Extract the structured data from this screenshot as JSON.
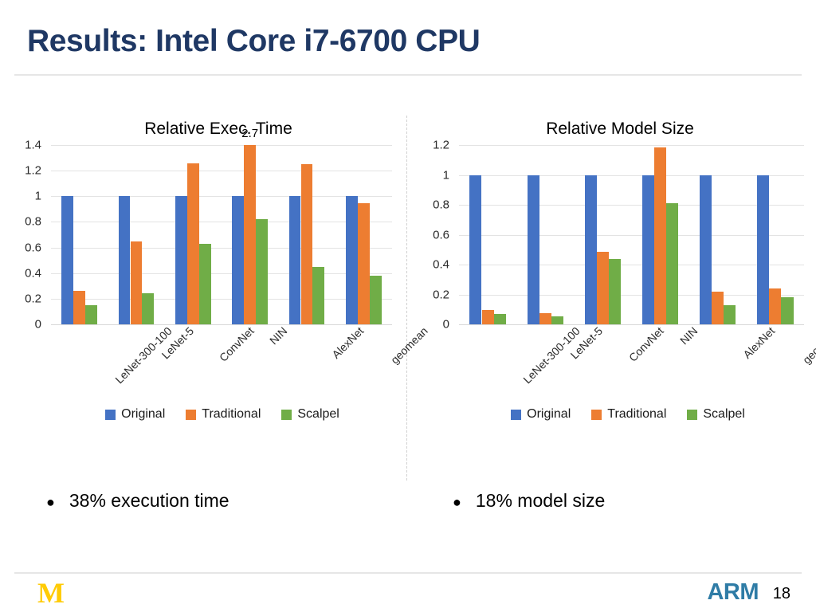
{
  "slide": {
    "title": "Results: Intel Core i7-6700 CPU",
    "page_number": "18"
  },
  "footer": {
    "university_logo": "M",
    "partner_logo": "ARM"
  },
  "colors": {
    "title": "#1F3864",
    "original": "#4472C4",
    "traditional": "#ED7D31",
    "scalpel": "#70AD47",
    "maize": "#FFCB05",
    "arm_blue": "#2F7CA6",
    "gridline": "#E3E3E3"
  },
  "bullets": {
    "left": "38% execution time",
    "right": "18% model size"
  },
  "legend": {
    "items": [
      {
        "label": "Original",
        "color": "#4472C4"
      },
      {
        "label": "Traditional",
        "color": "#ED7D31"
      },
      {
        "label": "Scalpel",
        "color": "#70AD47"
      }
    ]
  },
  "chart_data": [
    {
      "type": "bar",
      "title": "Relative Exec. Time",
      "xlabel": "",
      "ylabel": "",
      "ylim": [
        0,
        1.4
      ],
      "yticks": [
        0,
        0.2,
        0.4,
        0.6,
        0.8,
        1,
        1.2,
        1.4
      ],
      "ytick_labels": [
        "0",
        "0.2",
        "0.4",
        "0.6",
        "0.8",
        "1",
        "1.2",
        "1.4"
      ],
      "grid": true,
      "legend_position": "bottom",
      "categories": [
        "LeNet-300-100",
        "LeNet-5",
        "ConvNet",
        "NIN",
        "AlexNet",
        "geomean"
      ],
      "series": [
        {
          "name": "Original",
          "color": "#4472C4",
          "values": [
            1,
            1,
            1,
            1,
            1,
            1
          ]
        },
        {
          "name": "Traditional",
          "color": "#ED7D31",
          "values": [
            0.26,
            0.65,
            1.26,
            2.7,
            1.25,
            0.945
          ]
        },
        {
          "name": "Scalpel",
          "color": "#70AD47",
          "values": [
            0.15,
            0.24,
            0.63,
            0.82,
            0.45,
            0.38
          ]
        }
      ],
      "annotations": [
        {
          "text": "2.7",
          "series": "Traditional",
          "category": "NIN",
          "note": "value exceeds axis maximum; bar is clipped"
        }
      ]
    },
    {
      "type": "bar",
      "title": "Relative Model Size",
      "xlabel": "",
      "ylabel": "",
      "ylim": [
        0,
        1.2
      ],
      "yticks": [
        0,
        0.2,
        0.4,
        0.6,
        0.8,
        1,
        1.2
      ],
      "ytick_labels": [
        "0",
        "0.2",
        "0.4",
        "0.6",
        "0.8",
        "1",
        "1.2"
      ],
      "grid": true,
      "legend_position": "bottom",
      "categories": [
        "LeNet-300-100",
        "LeNet-5",
        "ConvNet",
        "NIN",
        "AlexNet",
        "geomean"
      ],
      "series": [
        {
          "name": "Original",
          "color": "#4472C4",
          "values": [
            1,
            1,
            1,
            1,
            1,
            1
          ]
        },
        {
          "name": "Traditional",
          "color": "#ED7D31",
          "values": [
            0.095,
            0.073,
            0.485,
            1.185,
            0.22,
            0.24
          ]
        },
        {
          "name": "Scalpel",
          "color": "#70AD47",
          "values": [
            0.07,
            0.053,
            0.44,
            0.81,
            0.13,
            0.18
          ]
        }
      ],
      "annotations": []
    }
  ]
}
